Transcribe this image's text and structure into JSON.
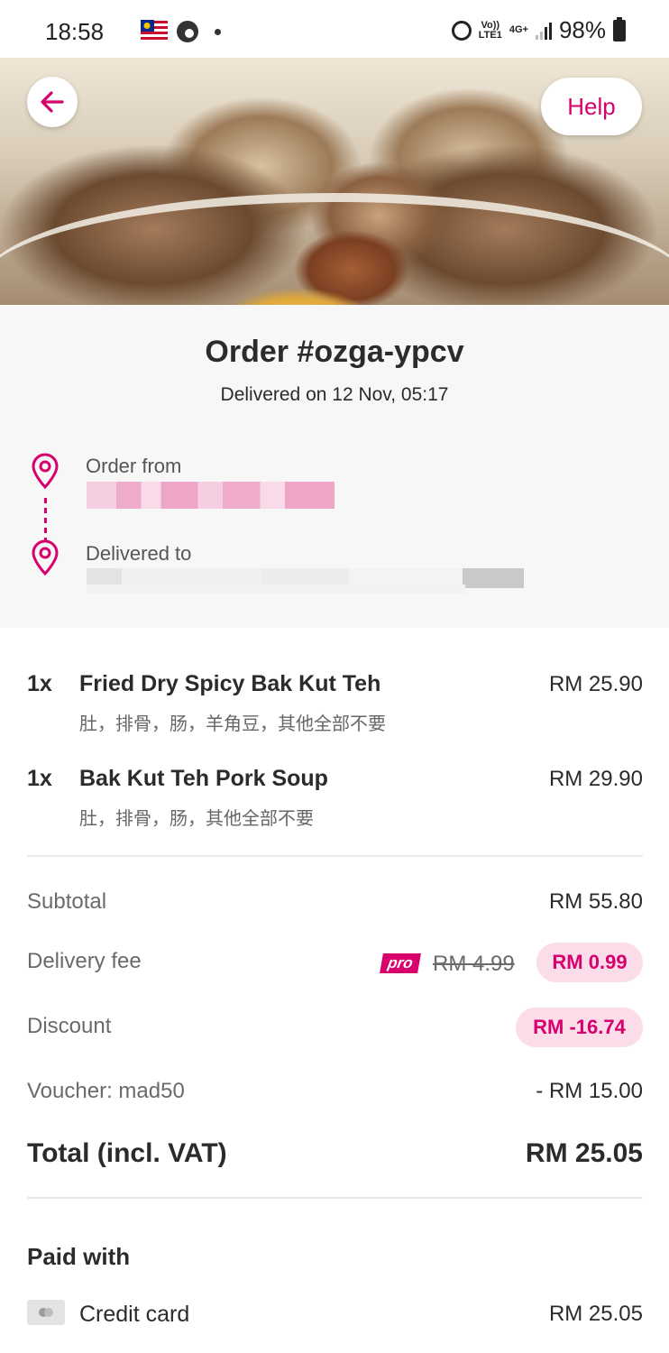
{
  "status_bar": {
    "time": "18:58",
    "volte": "Vo))\nLTE1",
    "network": "4G+",
    "battery": "98%"
  },
  "hero": {
    "image": "food-photo-bak-kut-teh",
    "help_label": "Help"
  },
  "order": {
    "title": "Order #ozga-ypcv",
    "subtitle": "Delivered on 12 Nov, 05:17",
    "from_label": "Order from",
    "to_label": "Delivered to"
  },
  "items": [
    {
      "qty": "1x",
      "name": "Fried Dry Spicy Bak Kut Teh",
      "price": "RM 25.90",
      "note": "肚，排骨，肠，羊角豆，其他全部不要"
    },
    {
      "qty": "1x",
      "name": "Bak Kut Teh Pork Soup",
      "price": "RM 29.90",
      "note": "肚，排骨，肠，其他全部不要"
    }
  ],
  "summary": {
    "subtotal_label": "Subtotal",
    "subtotal_value": "RM 55.80",
    "delivery_label": "Delivery fee",
    "pro_badge": "pro",
    "delivery_original": "RM 4.99",
    "delivery_value": "RM 0.99",
    "discount_label": "Discount",
    "discount_value": "RM -16.74",
    "voucher_label": "Voucher: mad50",
    "voucher_value": "- RM 15.00",
    "total_label": "Total (incl. VAT)",
    "total_value": "RM 25.05"
  },
  "payment": {
    "title": "Paid with",
    "method": "Credit card",
    "amount": "RM 25.05"
  },
  "colors": {
    "brand": "#d7006d",
    "pill_bg": "#fbdce9",
    "section_bg": "#f7f7f7"
  }
}
